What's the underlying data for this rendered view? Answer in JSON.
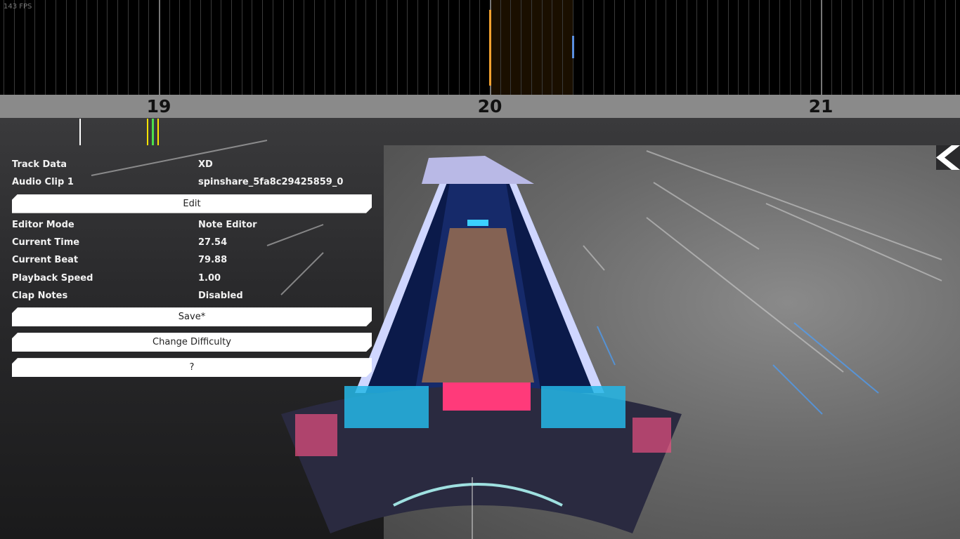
{
  "hud": {
    "fps": "143 FPS"
  },
  "timeline": {
    "beat_labels": [
      {
        "label": "19",
        "pos": 19
      },
      {
        "label": "20",
        "pos": 20
      },
      {
        "label": "21",
        "pos": 21
      }
    ],
    "selection_color": "#f0a030",
    "marker_color": "#5a8fe0"
  },
  "panel": {
    "rows_top": [
      {
        "key": "Track Data",
        "value": "XD"
      },
      {
        "key": "Audio Clip 1",
        "value": "spinshare_5fa8c29425859_0"
      }
    ],
    "edit_label": "Edit",
    "rows": [
      {
        "key": "Editor Mode",
        "value": "Note Editor"
      },
      {
        "key": "Current Time",
        "value": "27.54"
      },
      {
        "key": "Current Beat",
        "value": "79.88"
      },
      {
        "key": "Playback Speed",
        "value": "1.00"
      },
      {
        "key": "Clap Notes",
        "value": "Disabled"
      }
    ],
    "save_label": "Save*",
    "difficulty_label": "Change Difficulty",
    "help_label": "?"
  },
  "back_icon": "chevron-left-icon"
}
